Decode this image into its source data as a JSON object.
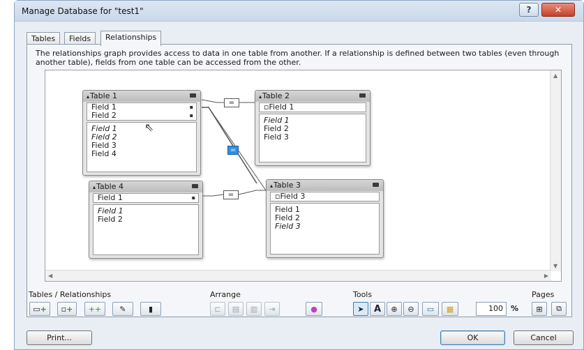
{
  "window": {
    "title": "Manage Database for \"test1\"",
    "help_label": "?",
    "close_label": "✕"
  },
  "tabs": [
    {
      "label": "Tables"
    },
    {
      "label": "Fields"
    },
    {
      "label": "Relationships",
      "active": true
    }
  ],
  "relationships": {
    "description": "The relationships graph provides access to data in one table from another. If a relationship is defined between two tables (even through another table), fields from one table can be accessed from the other.",
    "tables": [
      {
        "name": "Table 1",
        "keys": [
          "Field 1",
          "Field 2"
        ],
        "fields": [
          {
            "name": "Field 1",
            "italic": true
          },
          {
            "name": "Field 2",
            "italic": true
          },
          {
            "name": "Field 3",
            "italic": false
          },
          {
            "name": "Field 4",
            "italic": false
          }
        ]
      },
      {
        "name": "Table 2",
        "keys": [
          "Field 1"
        ],
        "fields": [
          {
            "name": "Field 1",
            "italic": true
          },
          {
            "name": "Field 2",
            "italic": false
          },
          {
            "name": "Field 3",
            "italic": false
          }
        ]
      },
      {
        "name": "Table 3",
        "keys": [
          "Field 3"
        ],
        "fields": [
          {
            "name": "Field 1",
            "italic": false
          },
          {
            "name": "Field 2",
            "italic": false
          },
          {
            "name": "Field 3",
            "italic": true
          }
        ]
      },
      {
        "name": "Table 4",
        "keys": [
          "Field 1"
        ],
        "fields": [
          {
            "name": "Field 1",
            "italic": true
          },
          {
            "name": "Field 2",
            "italic": false
          }
        ]
      }
    ],
    "relation_symbol": "="
  },
  "toolbar": {
    "tables_relationships_label": "Tables / Relationships",
    "arrange_label": "Arrange",
    "tools_label": "Tools",
    "pages_label": "Pages",
    "zoom_value": "100",
    "zoom_unit": "%",
    "icons": [
      "add-table-icon",
      "add-relationship-icon",
      "duplicate-icon",
      "edit-icon",
      "delete-icon",
      "align-left-icon",
      "align-top-icon",
      "distribute-horizontal-icon",
      "resize-icon",
      "color-icon",
      "pointer-icon",
      "text-tool-icon",
      "zoom-in-icon",
      "zoom-out-icon",
      "zoom-fit-icon",
      "note-icon",
      "page-break-icon",
      "page-setup-icon"
    ],
    "accent_color": "#2f8ee0"
  },
  "footer": {
    "print_label": "Print...",
    "ok_label": "OK",
    "cancel_label": "Cancel"
  }
}
